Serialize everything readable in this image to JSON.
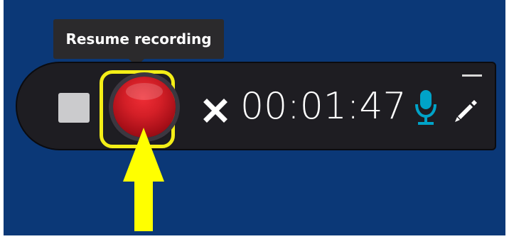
{
  "tooltip": {
    "text": "Resume recording"
  },
  "recorder": {
    "timer": "00:01:47",
    "controls": {
      "stop": "stop-icon",
      "record": "record-icon",
      "close": "close-icon",
      "microphone": "microphone-icon",
      "edit": "pencil-icon",
      "minimize": "minimize-icon"
    }
  },
  "annotation": {
    "highlight_color": "#f4ee17",
    "arrow_color": "#ffff00"
  },
  "colors": {
    "background": "#0b3877",
    "bar": "#1e1d22",
    "record_red": "#d41f27",
    "microphone_accent": "#00a3c8",
    "tooltip": "#2b2a2c"
  }
}
